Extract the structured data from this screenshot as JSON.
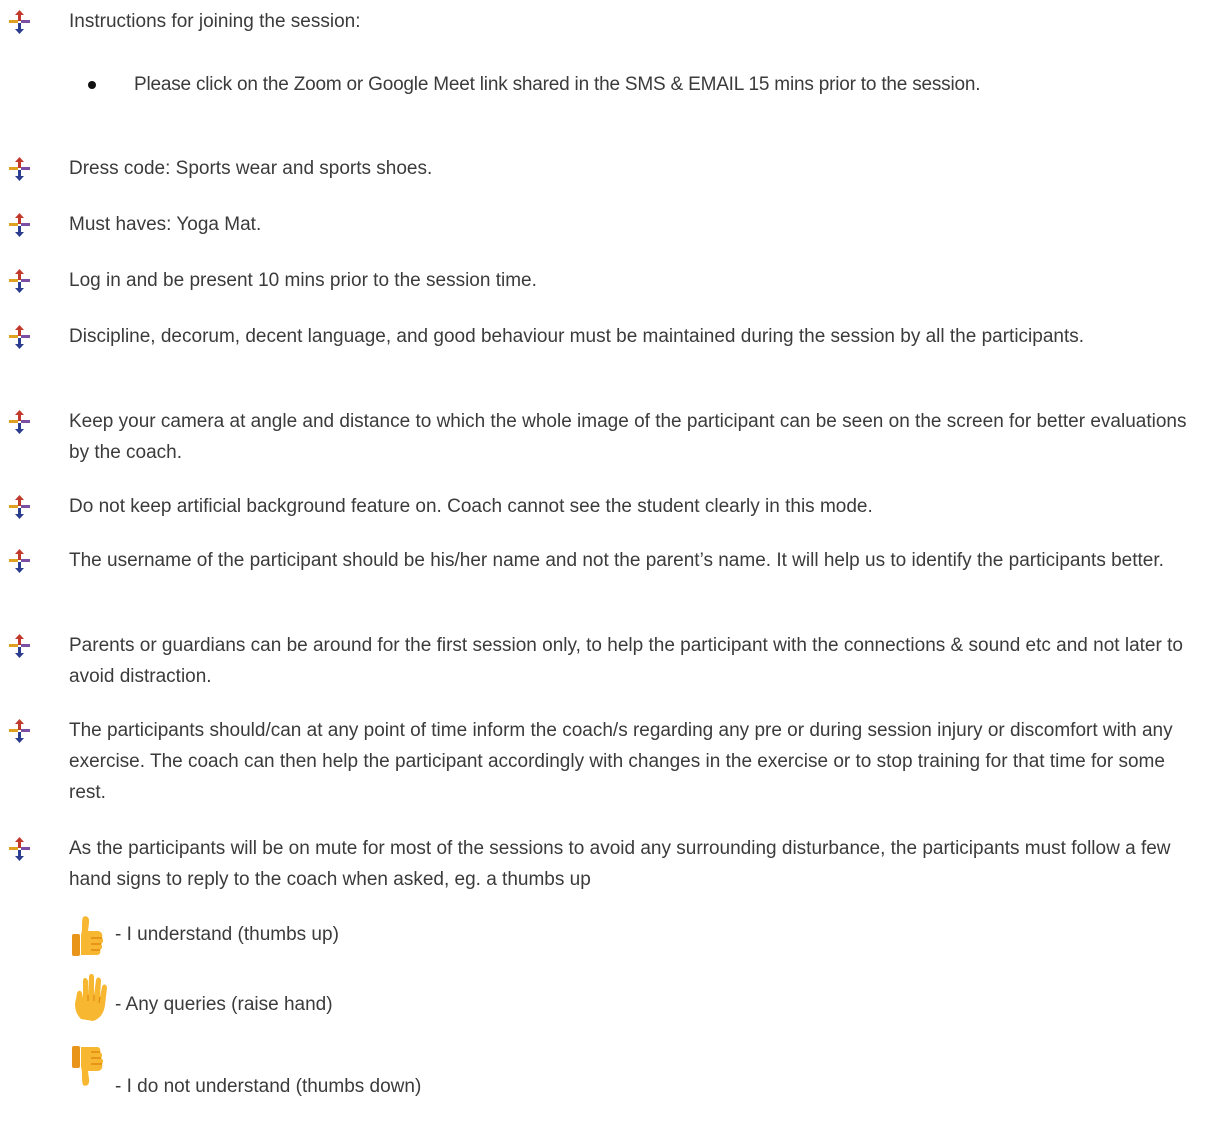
{
  "instructions_heading": "Instructions for joining the session:",
  "instructions_sub": "Please click on the Zoom or Google Meet link shared in the SMS & EMAIL 15 mins prior to the session.",
  "rules": [
    "Dress code: Sports wear and sports shoes.",
    "Must haves: Yoga Mat.",
    "Log in and be present 10 mins prior to the session time.",
    "Discipline, decorum, decent language, and good behaviour must be maintained during the session by all the participants.",
    "Keep your camera at angle and distance to which the whole image of the participant can be seen on the screen for better evaluations by the coach.",
    "Do not keep artificial background feature on. Coach cannot see the student clearly in this mode.",
    "The username of the participant should be his/her name and not the parent’s name. It will help us to identify the participants better.",
    "Parents or guardians can be around for the first session only, to help the participant with the connections & sound etc and not later to avoid distraction.",
    "The participants should/can at any point of time inform the coach/s regarding any pre or during session injury or discomfort with any exercise. The coach can then help the participant accordingly with changes in the exercise or to stop training for that time for some rest.",
    "As the participants will be on mute for most of the sessions to avoid any surrounding disturbance, the participants must follow a few hand signs to reply to the coach when asked, eg. a thumbs up"
  ],
  "hand_signs": [
    {
      "icon": "thumbs-up-icon",
      "label": " - I understand (thumbs up)"
    },
    {
      "icon": "raised-hand-icon",
      "label": "- Any queries (raise hand)"
    },
    {
      "icon": "thumbs-down-icon",
      "label": " - I do not understand (thumbs down)"
    }
  ],
  "colors": {
    "text": "#3b3b3b",
    "emoji_fill": "#f7b731",
    "emoji_shade": "#e8951a"
  }
}
